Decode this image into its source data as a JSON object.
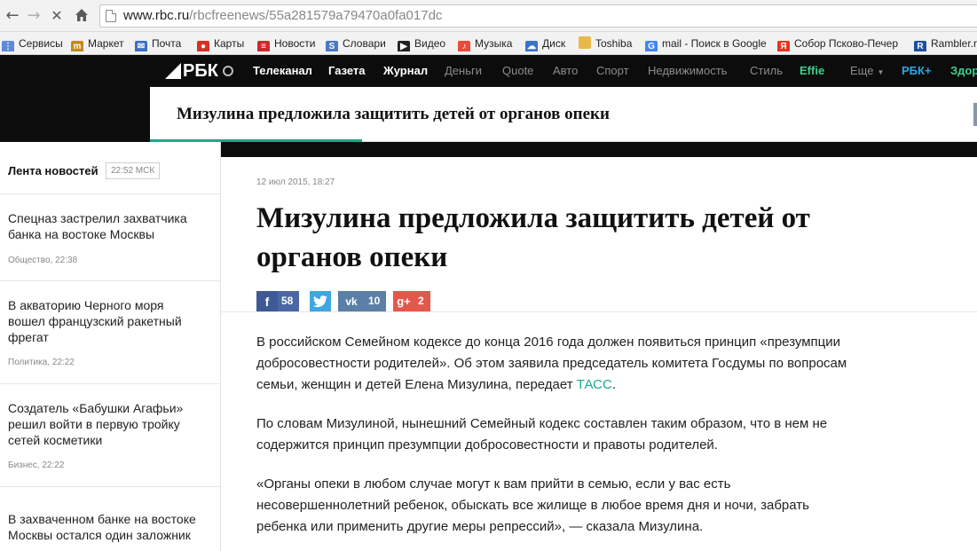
{
  "browser": {
    "url_host": "www.rbc.ru",
    "url_path": "/rbcfreenews/55a281579a79470a0fa017dc",
    "back_icon": "arrow-left-icon",
    "forward_icon": "arrow-right-icon",
    "stop_icon": "close-icon",
    "home_icon": "home-icon"
  },
  "bookmarks": [
    {
      "label": "Сервисы",
      "icon": "apps-grid-icon",
      "color": "#5b8bd9"
    },
    {
      "label": "Маркет",
      "icon": "market-icon",
      "color": "#c48a1a"
    },
    {
      "label": "Почта",
      "icon": "mail-icon",
      "color": "#3a6fbf"
    },
    {
      "label": "Карты",
      "icon": "map-pin-icon",
      "color": "#d93025"
    },
    {
      "label": "Новости",
      "icon": "news-icon",
      "color": "#cc2a2a"
    },
    {
      "label": "Словари",
      "icon": "dictionary-icon",
      "color": "#4b78c5"
    },
    {
      "label": "Видео",
      "icon": "video-icon",
      "color": "#222222"
    },
    {
      "label": "Музыка",
      "icon": "music-icon",
      "color": "#e94b3c"
    },
    {
      "label": "Диск",
      "icon": "disk-icon",
      "color": "#3b74c4"
    },
    {
      "label": "Toshiba",
      "icon": "folder-icon",
      "color": "#e9b84a"
    },
    {
      "label": "mail - Поиск в Google",
      "icon": "google-icon",
      "color": "#4285f4"
    },
    {
      "label": "Собор Псково-Печер",
      "icon": "yandex-icon",
      "color": "#e32"
    },
    {
      "label": "Rambler.ru",
      "icon": "rambler-icon",
      "color": "#1e4fa3"
    }
  ],
  "rbc": {
    "logo_text": "РБК",
    "logo_icon": "globe-icon",
    "nav": [
      {
        "label": "Телеканал",
        "color": "#ffffff"
      },
      {
        "label": "Газета",
        "color": "#ffffff"
      },
      {
        "label": "Журнал",
        "color": "#ffffff"
      },
      {
        "label": "Деньги",
        "color": "#8c8c8c"
      },
      {
        "label": "Quote",
        "color": "#8c8c8c"
      },
      {
        "label": "Авто",
        "color": "#8c8c8c"
      },
      {
        "label": "Спорт",
        "color": "#8c8c8c"
      },
      {
        "label": "Недвижимость",
        "color": "#8c8c8c"
      },
      {
        "label": "Стиль",
        "color": "#8c8c8c"
      },
      {
        "label": "Effie",
        "color": "#3ecf8e"
      },
      {
        "label": "Еще",
        "color": "#8c8c8c"
      },
      {
        "label": "РБК+",
        "color": "#29a7e1"
      },
      {
        "label": "Здор",
        "color": "#3ecf8e"
      }
    ],
    "more_icon": "caret-down-icon",
    "title_bar_text": "Мизулина предложила защитить детей от органов опеки",
    "accent_color": "#1ba98a"
  },
  "sidebar": {
    "heading": "Лента новостей",
    "time": "22:52 МСК",
    "items": [
      {
        "title": "Спецназ застрелил захватчика банка на востоке Москвы",
        "meta": "Общество, 22:38"
      },
      {
        "title": "В акваторию Черного моря вошел французский ракетный фрегат",
        "meta": "Политика, 22:22"
      },
      {
        "title": "Создатель «Бабушки Агафьи» решил войти в первую тройку сетей косметики",
        "meta": "Бизнес, 22:22"
      },
      {
        "title": "В захваченном банке на востоке Москвы остался один заложник",
        "meta": ""
      }
    ]
  },
  "article": {
    "date": "12 июл 2015, 18:27",
    "title": "Мизулина предложила защитить детей от органов опеки",
    "social": [
      {
        "network": "facebook",
        "icon": "facebook-icon",
        "count": "58",
        "color": "#4a67a5"
      },
      {
        "network": "twitter",
        "icon": "twitter-icon",
        "count": "",
        "color": "#3ea7e0"
      },
      {
        "network": "vkontakte",
        "icon": "vk-icon",
        "count": "10",
        "color": "#5b7fa6"
      },
      {
        "network": "google-plus",
        "icon": "google-plus-icon",
        "count": "2",
        "color": "#e4574b"
      }
    ],
    "p1_text": "В российском Семейном кодексе до конца 2016 года должен появиться принцип «презумпции добросовестности родителей». Об этом заявила председатель комитета Госдумы по вопросам семьи, женщин и детей Елена Мизулина, передает ",
    "p1_link": "ТАСС",
    "p1_end": ".",
    "p2": "По словам Мизулиной, нынешний Семейный кодекс составлен таким образом, что в нем не содержится принцип презумпции добросовестности и правоты родителей.",
    "p3": "«Органы опеки в любом случае могут к вам прийти в семью, если у вас есть несовершеннолетний ребенок, обыскать все жилище в любое время дня и ночи, забрать ребенка или применить другие меры репрессий», — сказала Мизулина."
  }
}
